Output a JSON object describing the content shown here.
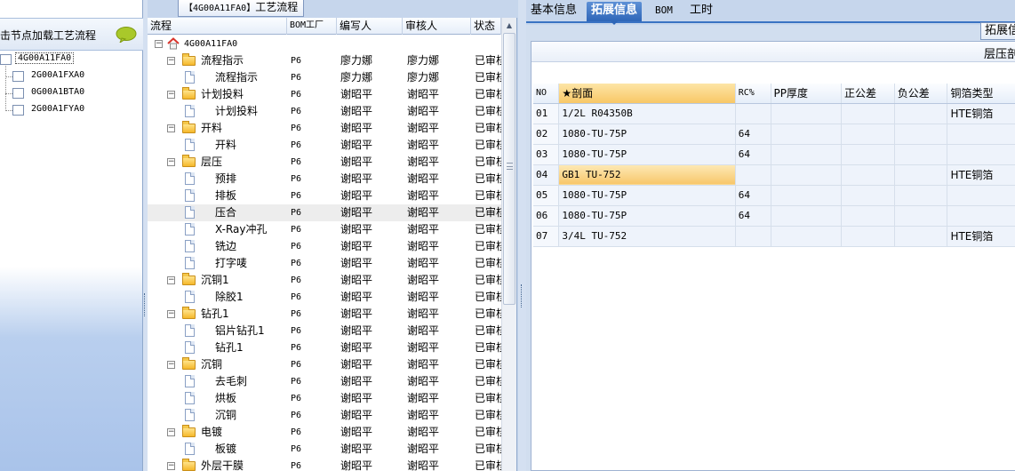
{
  "left_panel": {
    "header_text": "击节点加载工艺流程",
    "root_node": "4G00A11FA0",
    "children": [
      "2G00A1FXA0",
      "0G00A1BTA0",
      "2G00A1FYA0"
    ]
  },
  "middle_panel": {
    "title_code": "【4G00A11FA0】",
    "title_text": "工艺流程",
    "columns": {
      "flow": "流程",
      "bom_factory": "BOM工厂",
      "writer": "编写人",
      "reviewer": "审核人",
      "status": "状态"
    },
    "root": "4G00A11FA0",
    "rows": [
      {
        "name": "流程指示",
        "type": "folder",
        "factory": "P6",
        "writer": "廖力娜",
        "reviewer": "廖力娜",
        "status": "已审核"
      },
      {
        "name": "流程指示",
        "type": "doc",
        "factory": "P6",
        "writer": "廖力娜",
        "reviewer": "廖力娜",
        "status": "已审核"
      },
      {
        "name": "计划投料",
        "type": "folder",
        "factory": "P6",
        "writer": "谢昭平",
        "reviewer": "谢昭平",
        "status": "已审核"
      },
      {
        "name": "计划投料",
        "type": "doc",
        "factory": "P6",
        "writer": "谢昭平",
        "reviewer": "谢昭平",
        "status": "已审核"
      },
      {
        "name": "开料",
        "type": "folder",
        "factory": "P6",
        "writer": "谢昭平",
        "reviewer": "谢昭平",
        "status": "已审核"
      },
      {
        "name": "开料",
        "type": "doc",
        "factory": "P6",
        "writer": "谢昭平",
        "reviewer": "谢昭平",
        "status": "已审核"
      },
      {
        "name": "层压",
        "type": "folder",
        "factory": "P6",
        "writer": "谢昭平",
        "reviewer": "谢昭平",
        "status": "已审核"
      },
      {
        "name": "预排",
        "type": "doc",
        "factory": "P6",
        "writer": "谢昭平",
        "reviewer": "谢昭平",
        "status": "已审核"
      },
      {
        "name": "排板",
        "type": "doc",
        "factory": "P6",
        "writer": "谢昭平",
        "reviewer": "谢昭平",
        "status": "已审核"
      },
      {
        "name": "压合",
        "type": "doc",
        "factory": "P6",
        "writer": "谢昭平",
        "reviewer": "谢昭平",
        "status": "已审核",
        "highlight": true
      },
      {
        "name": "X-Ray冲孔",
        "type": "doc",
        "factory": "P6",
        "writer": "谢昭平",
        "reviewer": "谢昭平",
        "status": "已审核"
      },
      {
        "name": "铣边",
        "type": "doc",
        "factory": "P6",
        "writer": "谢昭平",
        "reviewer": "谢昭平",
        "status": "已审核"
      },
      {
        "name": "打字唛",
        "type": "doc",
        "factory": "P6",
        "writer": "谢昭平",
        "reviewer": "谢昭平",
        "status": "已审核"
      },
      {
        "name": "沉铜1",
        "type": "folder",
        "factory": "P6",
        "writer": "谢昭平",
        "reviewer": "谢昭平",
        "status": "已审核"
      },
      {
        "name": "除胶1",
        "type": "doc",
        "factory": "P6",
        "writer": "谢昭平",
        "reviewer": "谢昭平",
        "status": "已审核"
      },
      {
        "name": "钻孔1",
        "type": "folder",
        "factory": "P6",
        "writer": "谢昭平",
        "reviewer": "谢昭平",
        "status": "已审核"
      },
      {
        "name": "铝片钻孔1",
        "type": "doc",
        "factory": "P6",
        "writer": "谢昭平",
        "reviewer": "谢昭平",
        "status": "已审核"
      },
      {
        "name": "钻孔1",
        "type": "doc",
        "factory": "P6",
        "writer": "谢昭平",
        "reviewer": "谢昭平",
        "status": "已审核"
      },
      {
        "name": "沉铜",
        "type": "folder",
        "factory": "P6",
        "writer": "谢昭平",
        "reviewer": "谢昭平",
        "status": "已审核"
      },
      {
        "name": "去毛刺",
        "type": "doc",
        "factory": "P6",
        "writer": "谢昭平",
        "reviewer": "谢昭平",
        "status": "已审核"
      },
      {
        "name": "烘板",
        "type": "doc",
        "factory": "P6",
        "writer": "谢昭平",
        "reviewer": "谢昭平",
        "status": "已审核"
      },
      {
        "name": "沉铜",
        "type": "doc",
        "factory": "P6",
        "writer": "谢昭平",
        "reviewer": "谢昭平",
        "status": "已审核"
      },
      {
        "name": "电镀",
        "type": "folder",
        "factory": "P6",
        "writer": "谢昭平",
        "reviewer": "谢昭平",
        "status": "已审核"
      },
      {
        "name": "板镀",
        "type": "doc",
        "factory": "P6",
        "writer": "谢昭平",
        "reviewer": "谢昭平",
        "status": "已审核"
      },
      {
        "name": "外层干膜",
        "type": "folder",
        "factory": "P6",
        "writer": "谢昭平",
        "reviewer": "谢昭平",
        "status": "已审核"
      }
    ]
  },
  "right_panel": {
    "tabs": [
      {
        "label": "基本信息",
        "active": false
      },
      {
        "label": "拓展信息",
        "active": true
      },
      {
        "label": "BOM",
        "active": false
      },
      {
        "label": "工时",
        "active": false
      }
    ],
    "subtab_label": "拓展信",
    "group_title": "层压剖",
    "columns": [
      "NO",
      "★剖面",
      "RC%",
      "PP厚度",
      "正公差",
      "负公差",
      "铜箔类型"
    ],
    "rows": [
      {
        "no": "01",
        "profile": "1/2L  R04350B",
        "rc": "",
        "pp": "",
        "pos_tol": "",
        "neg_tol": "",
        "foil": "HTE铜箔"
      },
      {
        "no": "02",
        "profile": "1080-TU-75P",
        "rc": "64",
        "pp": "",
        "pos_tol": "",
        "neg_tol": "",
        "foil": ""
      },
      {
        "no": "03",
        "profile": "1080-TU-75P",
        "rc": "64",
        "pp": "",
        "pos_tol": "",
        "neg_tol": "",
        "foil": ""
      },
      {
        "no": "04",
        "profile": "GB1  TU-752",
        "rc": "",
        "pp": "",
        "pos_tol": "",
        "neg_tol": "",
        "foil": "HTE铜箔",
        "highlight": true
      },
      {
        "no": "05",
        "profile": "1080-TU-75P",
        "rc": "64",
        "pp": "",
        "pos_tol": "",
        "neg_tol": "",
        "foil": ""
      },
      {
        "no": "06",
        "profile": "1080-TU-75P",
        "rc": "64",
        "pp": "",
        "pos_tol": "",
        "neg_tol": "",
        "foil": ""
      },
      {
        "no": "07",
        "profile": "3/4L  TU-752",
        "rc": "",
        "pp": "",
        "pos_tol": "",
        "neg_tol": "",
        "foil": "HTE铜箔"
      }
    ]
  },
  "colors": {
    "accent": "#2e66b8",
    "selected_cell": "#f7c66a",
    "panel_background": "#c6d6ec"
  }
}
